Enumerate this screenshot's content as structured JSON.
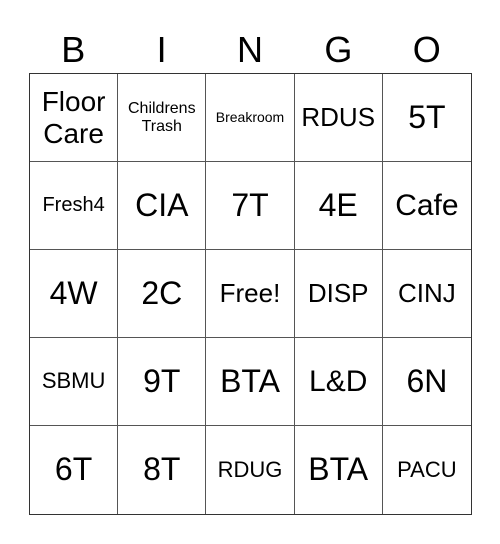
{
  "header": [
    "B",
    "I",
    "N",
    "G",
    "O"
  ],
  "cells": [
    [
      "Floor Care",
      "Childrens Trash",
      "Breakroom",
      "RDUS",
      "5T"
    ],
    [
      "Fresh4",
      "CIA",
      "7T",
      "4E",
      "Cafe"
    ],
    [
      "4W",
      "2C",
      "Free!",
      "DISP",
      "CINJ"
    ],
    [
      "SBMU",
      "9T",
      "BTA",
      "L&D",
      "6N"
    ],
    [
      "6T",
      "8T",
      "RDUG",
      "BTA",
      "PACU"
    ]
  ]
}
